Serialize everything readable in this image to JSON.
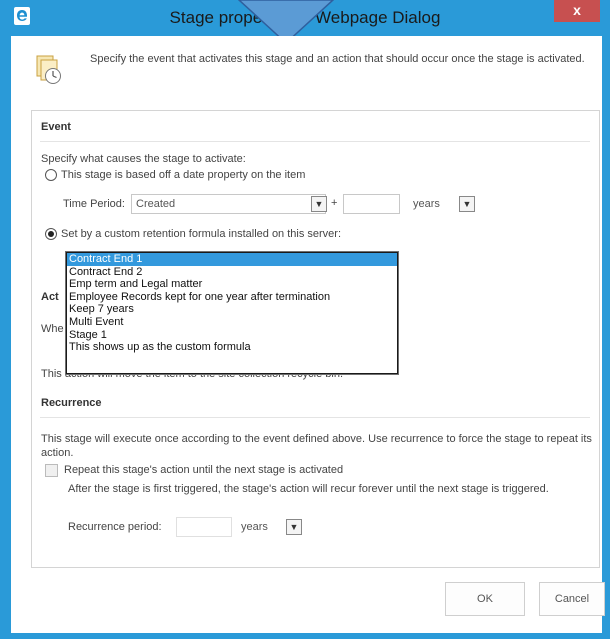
{
  "window": {
    "title": "Stage properties -- Webpage Dialog",
    "close_glyph": "x"
  },
  "header": {
    "description": "Specify the event that activates this stage and an action that should occur once the stage is activated."
  },
  "event": {
    "section_title": "Event",
    "instruction": "Specify what causes the stage to activate:",
    "date_option_label": "This stage is based off a date property on the item",
    "time_period_label": "Time Period:",
    "time_period_value": "Created",
    "plus_sign": "+",
    "offset_value": "",
    "offset_unit": "years",
    "formula_option_label": "Set by a custom retention formula installed on this server:",
    "formula_options": [
      "Contract End 1",
      "Contract End 2",
      "Emp term and Legal matter",
      "Employee Records kept for one year after termination",
      "Keep 7 years",
      "Multi Event",
      "Stage 1",
      "This shows up as the custom formula"
    ]
  },
  "action": {
    "section_title_partial": "Act",
    "instruction_partial": "Whe",
    "note": "This action will move the item to the site collection recycle bin."
  },
  "recurrence": {
    "section_title": "Recurrence",
    "description": "This stage will execute once according to the event defined above. Use recurrence to force the stage to repeat its action.",
    "checkbox_label": "Repeat this stage's action until the next stage is activated",
    "note": "After the stage is first triggered, the stage's action will recur forever until the next stage is triggered.",
    "period_label": "Recurrence period:",
    "period_value": "",
    "period_unit": "years"
  },
  "buttons": {
    "ok": "OK",
    "cancel": "Cancel"
  }
}
